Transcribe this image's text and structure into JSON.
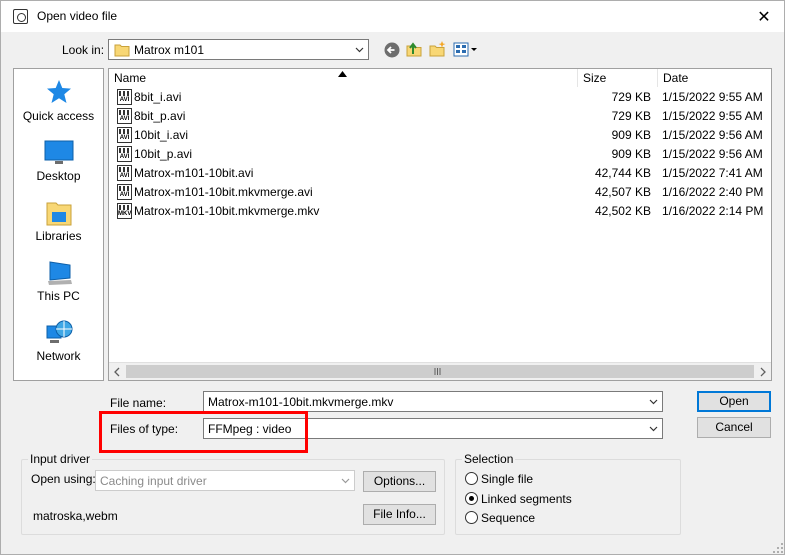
{
  "window": {
    "title": "Open video file"
  },
  "look_in": {
    "label": "Look in:",
    "value": "Matrox m101"
  },
  "toolbar": {
    "back": "back-icon",
    "up": "up-folder-icon",
    "new_folder": "new-folder-icon",
    "views": "view-menu-icon"
  },
  "places": [
    {
      "label": "Quick access",
      "icon": "star-icon"
    },
    {
      "label": "Desktop",
      "icon": "desktop-icon"
    },
    {
      "label": "Libraries",
      "icon": "libraries-icon"
    },
    {
      "label": "This PC",
      "icon": "computer-icon"
    },
    {
      "label": "Network",
      "icon": "network-icon"
    }
  ],
  "columns": {
    "name": "Name",
    "size": "Size",
    "date": "Date"
  },
  "files": [
    {
      "name": "8bit_i.avi",
      "ext": "AVI",
      "size": "729 KB",
      "date": "1/15/2022 9:55 AM"
    },
    {
      "name": "8bit_p.avi",
      "ext": "AVI",
      "size": "729 KB",
      "date": "1/15/2022 9:55 AM"
    },
    {
      "name": "10bit_i.avi",
      "ext": "AVI",
      "size": "909 KB",
      "date": "1/15/2022 9:56 AM"
    },
    {
      "name": "10bit_p.avi",
      "ext": "AVI",
      "size": "909 KB",
      "date": "1/15/2022 9:56 AM"
    },
    {
      "name": "Matrox-m101-10bit.avi",
      "ext": "AVI",
      "size": "42,744 KB",
      "date": "1/15/2022 7:41 AM"
    },
    {
      "name": "Matrox-m101-10bit.mkvmerge.avi",
      "ext": "AVI",
      "size": "42,507 KB",
      "date": "1/16/2022 2:40 PM"
    },
    {
      "name": "Matrox-m101-10bit.mkvmerge.mkv",
      "ext": "MKV",
      "size": "42,502 KB",
      "date": "1/16/2022 2:14 PM"
    }
  ],
  "file_name": {
    "label": "File name:",
    "value": "Matrox-m101-10bit.mkvmerge.mkv"
  },
  "file_type": {
    "label": "Files of type:",
    "value": "FFMpeg : video"
  },
  "buttons": {
    "open": "Open",
    "cancel": "Cancel"
  },
  "input_driver": {
    "title": "Input driver",
    "open_using_label": "Open using:",
    "open_using_value": "Caching input driver",
    "options_label": "Options...",
    "extensions": "matroska,webm",
    "file_info_label": "File Info..."
  },
  "selection": {
    "title": "Selection",
    "options": [
      "Single file",
      "Linked segments",
      "Sequence"
    ],
    "selected_index": 1
  },
  "colors": {
    "highlight": "#ff0000",
    "default_button_border": "#0078d7"
  }
}
